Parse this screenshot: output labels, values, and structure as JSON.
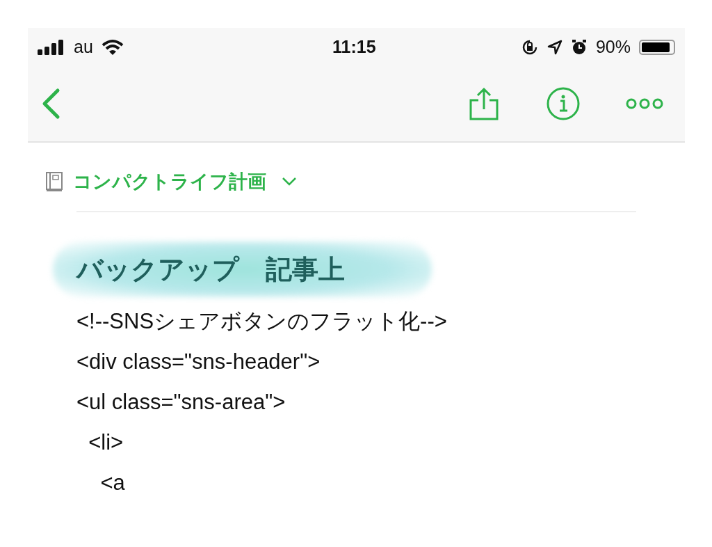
{
  "status_bar": {
    "carrier": "au",
    "time": "11:15",
    "battery": "90%"
  },
  "notebook": {
    "name": "コンパクトライフ計画"
  },
  "note": {
    "heading": "バックアップ　記事上",
    "lines": [
      "<!--SNSシェアボタンのフラット化-->",
      "<div class=\"sns-header\">",
      "<ul class=\"sns-area\">",
      "  <li>",
      "    <a"
    ]
  }
}
